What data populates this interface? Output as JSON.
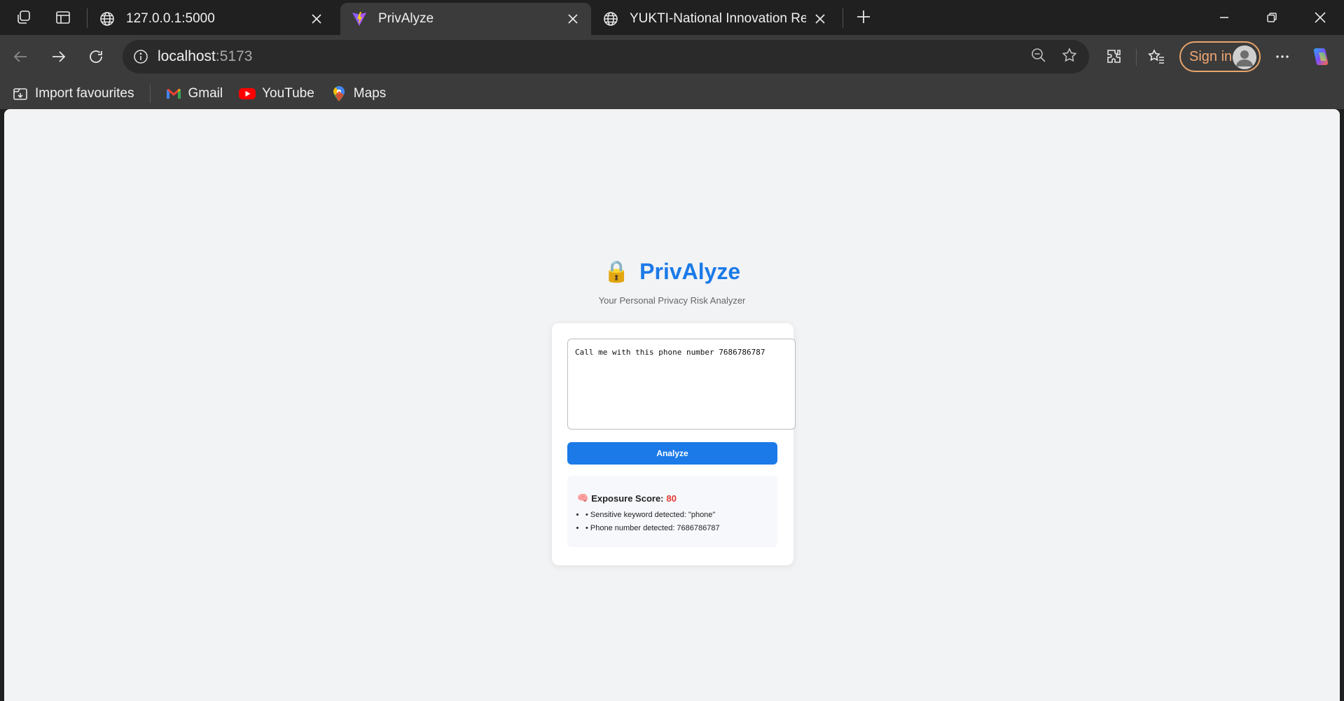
{
  "browser": {
    "tabs": [
      {
        "title": "127.0.0.1:5000",
        "active": false
      },
      {
        "title": "PrivAlyze",
        "active": true
      },
      {
        "title": "YUKTI-National Innovation Repository",
        "active": false
      }
    ],
    "url_host": "localhost",
    "url_port": ":5173",
    "signin_label": "Sign in",
    "bookmarks": [
      {
        "label": "Import favourites",
        "icon": "import-icon"
      },
      {
        "label": "Gmail",
        "icon": "gmail-icon"
      },
      {
        "label": "YouTube",
        "icon": "youtube-icon"
      },
      {
        "label": "Maps",
        "icon": "maps-icon"
      }
    ]
  },
  "app": {
    "lock_emoji": "🔒",
    "title": "PrivAlyze",
    "subtitle": "Your Personal Privacy Risk Analyzer",
    "input_text": "Call me with this phone number 7686786787",
    "analyze_label": "Analyze",
    "result": {
      "brain_emoji": "🧠",
      "score_label": "Exposure Score:",
      "score_value": "80",
      "findings": [
        "• Sensitive keyword detected: \"phone\"",
        "• Phone number detected: 7686786787"
      ]
    }
  },
  "colors": {
    "accent": "#1b7ae8",
    "score_red": "#e53935",
    "signin_border": "#e8a56a"
  }
}
